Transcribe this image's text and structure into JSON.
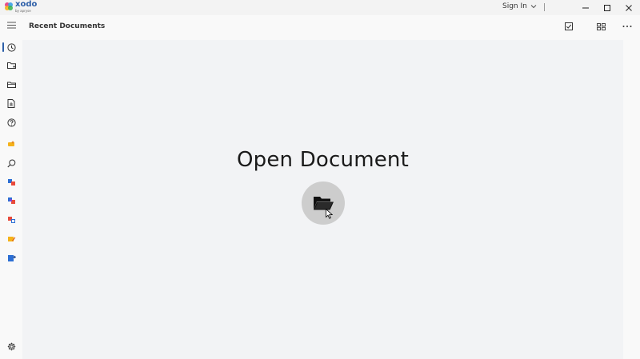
{
  "app": {
    "name": "xodo",
    "byline": "by apryse"
  },
  "titlebar": {
    "signin_label": "Sign In",
    "minimize_label": "minimize",
    "maximize_label": "maximize",
    "close_label": "close"
  },
  "header": {
    "title": "Recent Documents"
  },
  "main": {
    "open_title": "Open Document"
  },
  "rail": {
    "items": [
      {
        "name": "recent",
        "icon": "clock-icon",
        "active": true
      },
      {
        "name": "folder",
        "icon": "folder-icon"
      },
      {
        "name": "files",
        "icon": "open-folder-icon"
      },
      {
        "name": "document",
        "icon": "document-icon"
      },
      {
        "name": "help",
        "icon": "question-icon"
      },
      {
        "name": "tool-1",
        "icon": "sparkle-icon"
      },
      {
        "name": "search",
        "icon": "search-icon"
      },
      {
        "name": "tool-2",
        "icon": "convert-icon"
      },
      {
        "name": "tool-3",
        "icon": "merge-icon"
      },
      {
        "name": "tool-4",
        "icon": "compress-icon"
      },
      {
        "name": "tool-5",
        "icon": "edit-icon"
      },
      {
        "name": "tool-6",
        "icon": "export-icon"
      },
      {
        "name": "settings",
        "icon": "gear-icon"
      }
    ]
  },
  "colors": {
    "accent": "#2d5fa8",
    "content_bg": "#f2f3f5",
    "open_button": "#cdcdcd"
  }
}
